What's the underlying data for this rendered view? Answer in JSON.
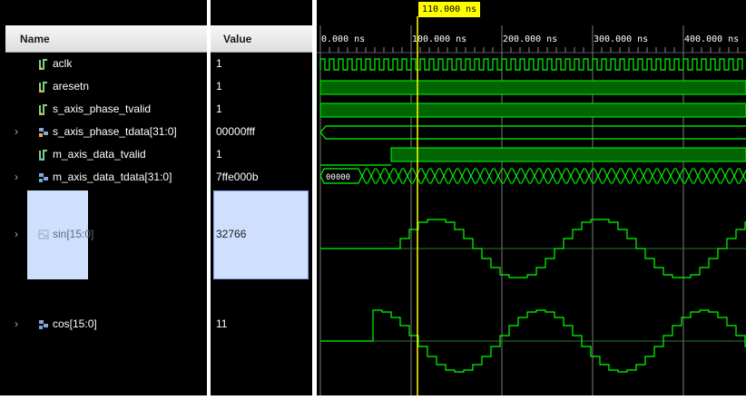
{
  "columns": {
    "name": "Name",
    "value": "Value"
  },
  "cursor": {
    "time_label": "110.000 ns"
  },
  "timeline": {
    "ticks": [
      "0.000 ns",
      "100.000 ns",
      "200.000 ns",
      "300.000 ns",
      "400.000 ns"
    ]
  },
  "signals": [
    {
      "name": "aclk",
      "value": "1"
    },
    {
      "name": "aresetn",
      "value": "1"
    },
    {
      "name": "s_axis_phase_tvalid",
      "value": "1"
    },
    {
      "name": "s_axis_phase_tdata[31:0]",
      "value": "00000fff"
    },
    {
      "name": "m_axis_data_tvalid",
      "value": "1"
    },
    {
      "name": "m_axis_data_tdata[31:0]",
      "value": "7ffe000b"
    },
    {
      "name": "sin[15:0]",
      "value": "32766"
    },
    {
      "name": "cos[15:0]",
      "value": "11"
    }
  ],
  "waves": {
    "tdata_first_value": "00000"
  },
  "colors": {
    "wave": "#00ff00",
    "fill": "#006400",
    "cursor": "#ffff00",
    "grid": "#7a7a7a",
    "selection": "#cfe0ff"
  },
  "icons": {
    "bit": "single-bit-signal-icon",
    "bus": "bus-signal-icon",
    "analog": "analog-signal-icon"
  }
}
